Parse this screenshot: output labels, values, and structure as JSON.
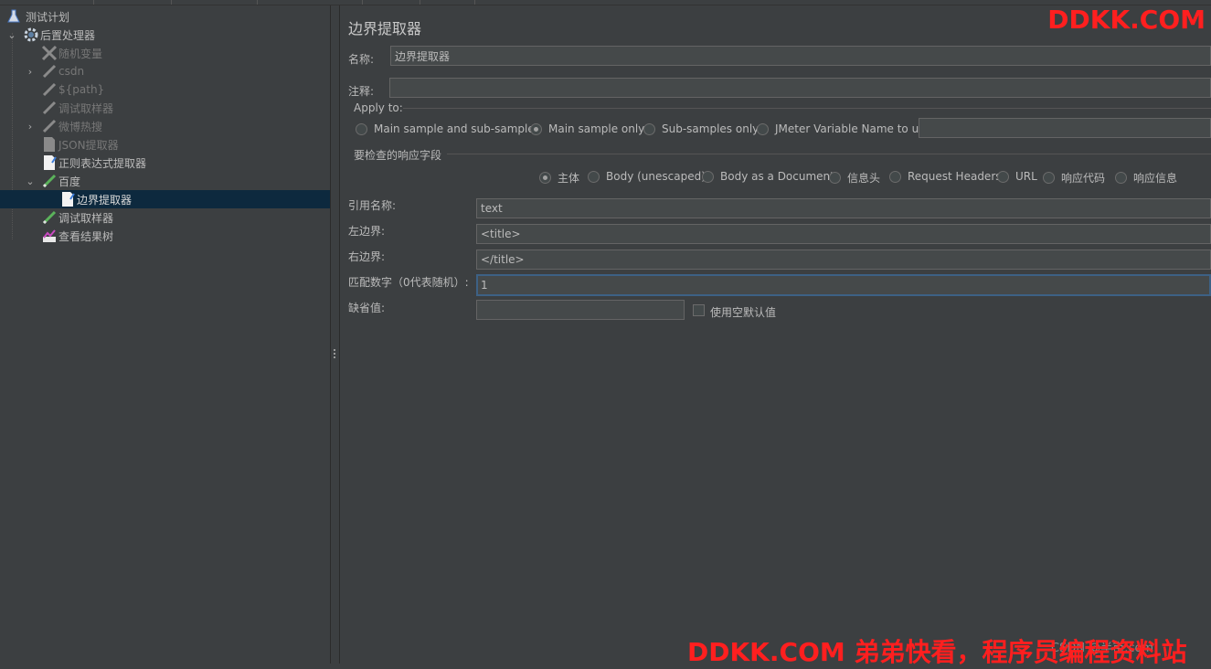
{
  "tree": {
    "items": [
      {
        "label": "测试计划",
        "icon": "flask-icon"
      },
      {
        "label": "后置处理器",
        "icon": "gear-icon"
      },
      {
        "label": "随机变量",
        "icon": "tools-icon"
      },
      {
        "label": "csdn",
        "icon": "sampler-pen-icon"
      },
      {
        "label": "${path}",
        "icon": "sampler-pen-icon"
      },
      {
        "label": "调试取样器",
        "icon": "sampler-pen-icon"
      },
      {
        "label": "微博热搜",
        "icon": "sampler-pen-icon"
      },
      {
        "label": "JSON提取器",
        "icon": "extractor-doc-icon"
      },
      {
        "label": "正则表达式提取器",
        "icon": "extractor-doc-icon"
      },
      {
        "label": "百度",
        "icon": "sampler-pen-icon"
      },
      {
        "label": "边界提取器",
        "icon": "extractor-doc-icon"
      },
      {
        "label": "调试取样器",
        "icon": "sampler-pen-icon"
      },
      {
        "label": "查看结果树",
        "icon": "graph-icon"
      }
    ]
  },
  "panel": {
    "title": "边界提取器",
    "name_label": "名称:",
    "name_value": "边界提取器",
    "comment_label": "注释:",
    "comment_value": "",
    "apply_to": {
      "legend": "Apply to:",
      "options": [
        "Main sample and sub-samples",
        "Main sample only",
        "Sub-samples only",
        "JMeter Variable Name to use"
      ],
      "selected": "Main sample only",
      "variable_value": ""
    },
    "response_field": {
      "legend": "要检查的响应字段",
      "options": [
        "主体",
        "Body (unescaped)",
        "Body as a Document",
        "信息头",
        "Request Headers",
        "URL",
        "响应代码",
        "响应信息"
      ],
      "selected": "主体"
    },
    "ref_name_label": "引用名称:",
    "ref_name_value": "text",
    "left_bound_label": "左边界:",
    "left_bound_value": "<title>",
    "right_bound_label": "右边界:",
    "right_bound_value": "</title>",
    "match_no_label": "匹配数字（0代表随机）:",
    "match_no_value": "1",
    "default_label": "缺省值:",
    "default_value": "",
    "empty_default_label": "使用空默认值",
    "empty_default_checked": false
  },
  "watermark": {
    "top": "DDKK.COM",
    "bottom": "DDKK.COM 弟弟快看，程序员编程资料站",
    "faint": "CSDN @半亩.com"
  },
  "colors": {
    "background": "#3c3f41",
    "selection": "#0d293e",
    "field_bg": "#45494a",
    "focus_border": "#3d6185",
    "watermark": "#ff1f1f"
  }
}
